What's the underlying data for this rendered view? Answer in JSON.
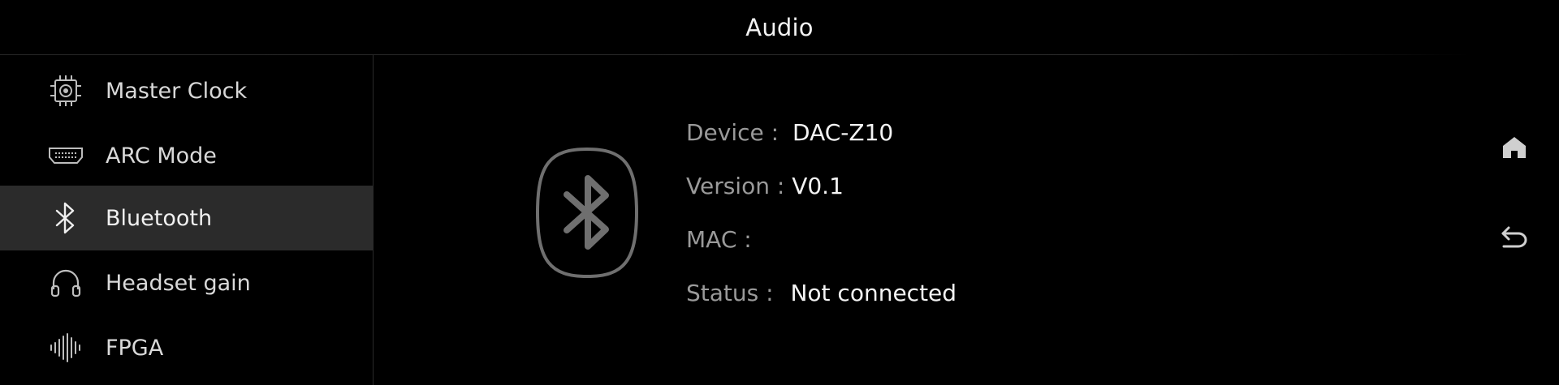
{
  "header": {
    "title": "Audio"
  },
  "sidebar": {
    "items": [
      {
        "label": "Master Clock",
        "icon": "chip-clock-icon"
      },
      {
        "label": "ARC Mode",
        "icon": "hdmi-port-icon"
      },
      {
        "label": "Bluetooth",
        "icon": "bluetooth-icon",
        "selected": true
      },
      {
        "label": "Headset gain",
        "icon": "headphones-icon"
      },
      {
        "label": "FPGA",
        "icon": "waveform-icon"
      }
    ]
  },
  "details": {
    "device_label": "Device :",
    "device_value": "DAC-Z10",
    "version_label": "Version :",
    "version_value": "V0.1",
    "mac_label": "MAC :",
    "mac_value": "",
    "status_label": "Status :",
    "status_value": "Not connected"
  },
  "rail": {
    "home_icon": "home-icon",
    "back_icon": "back-arrow-icon"
  },
  "colors": {
    "background": "#000000",
    "selected_row": "#2b2b2b",
    "label_gray": "#9a9a9a",
    "value_white": "#f4f4f4"
  }
}
